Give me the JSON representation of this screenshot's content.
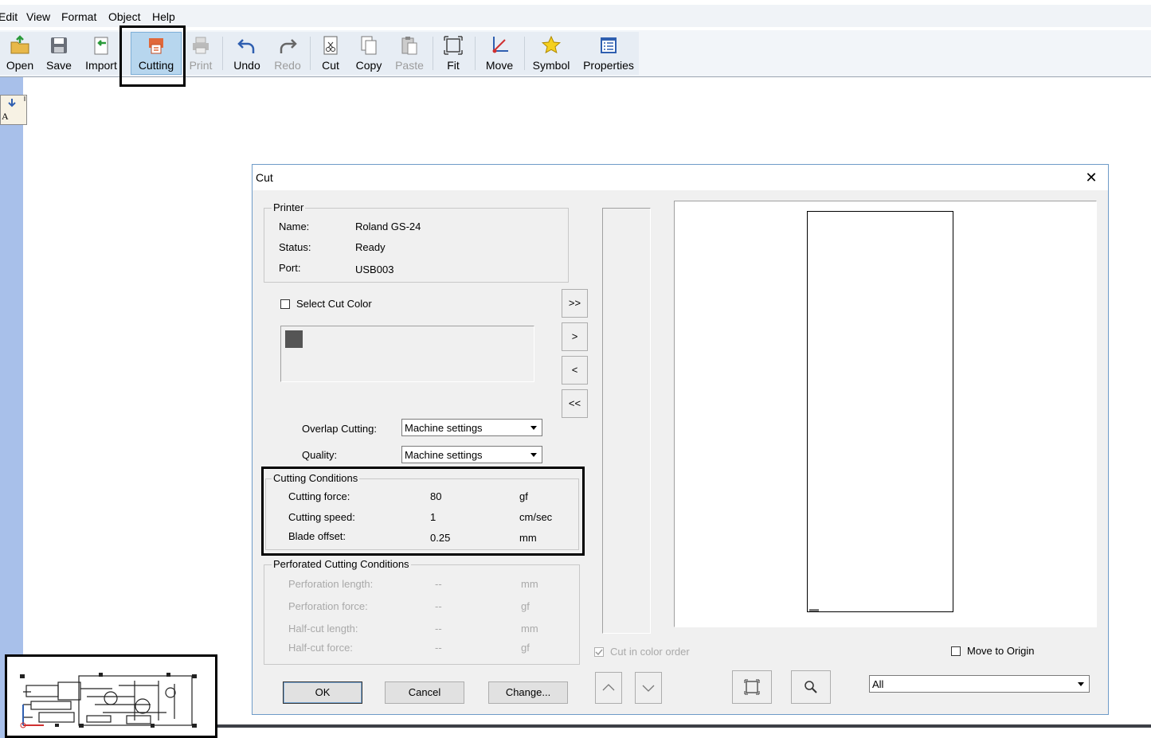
{
  "menu": [
    "Edit",
    "View",
    "Format",
    "Object",
    "Help"
  ],
  "toolbar": {
    "open": "Open",
    "save": "Save",
    "import": "Import",
    "cutting": "Cutting",
    "print": "Print",
    "undo": "Undo",
    "redo": "Redo",
    "cut": "Cut",
    "copy": "Copy",
    "paste": "Paste",
    "fit": "Fit",
    "move": "Move",
    "symbol": "Symbol",
    "properties": "Properties"
  },
  "dialog": {
    "title": "Cut",
    "close": "✕",
    "printer": {
      "group_title": "Printer",
      "name_label": "Name:",
      "name_value": "Roland GS-24",
      "status_label": "Status:",
      "status_value": "Ready",
      "port_label": "Port:",
      "port_value": "USB003"
    },
    "select_cut_color": "Select Cut Color",
    "arrows": [
      ">>",
      ">",
      "<",
      "<<"
    ],
    "overlap_label": "Overlap Cutting:",
    "overlap_value": "Machine settings",
    "quality_label": "Quality:",
    "quality_value": "Machine settings",
    "conditions": {
      "group_title": "Cutting Conditions",
      "force_label": "Cutting force:",
      "force_value": "80",
      "force_unit": "gf",
      "speed_label": "Cutting speed:",
      "speed_value": "1",
      "speed_unit": "cm/sec",
      "offset_label": "Blade offset:",
      "offset_value": "0.25",
      "offset_unit": "mm"
    },
    "perforated": {
      "group_title": "Perforated Cutting Conditions",
      "rows": [
        {
          "label": "Perforation length:",
          "value": "--",
          "unit": "mm"
        },
        {
          "label": "Perforation  force:",
          "value": "--",
          "unit": "gf"
        },
        {
          "label": "Half-cut length:",
          "value": "--",
          "unit": "mm"
        },
        {
          "label": "Half-cut force:",
          "value": "--",
          "unit": "gf"
        }
      ]
    },
    "cut_in_color_order": "Cut in color order",
    "move_to_origin": "Move to Origin",
    "ok": "OK",
    "cancel": "Cancel",
    "change": "Change...",
    "view_select": "All"
  },
  "colors": {
    "accent_highlight": "#b7d6ee",
    "workspace_strip": "#a8c0ea",
    "swatch": "#555555"
  }
}
